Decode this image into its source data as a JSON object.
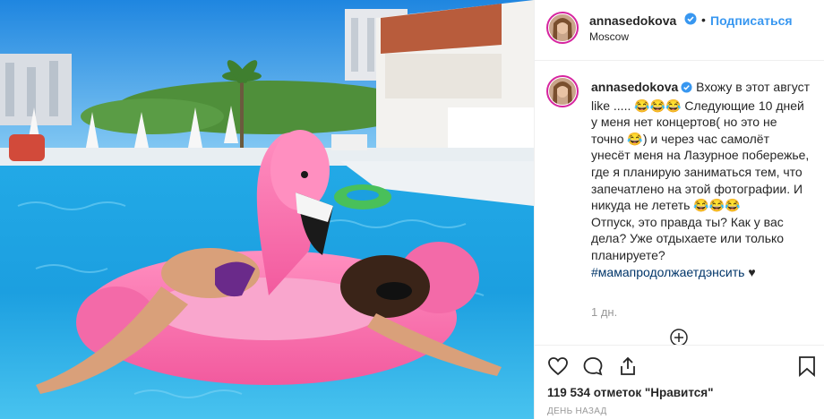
{
  "post": {
    "photo_alt": "photo",
    "author": {
      "username": "annasedokova",
      "verified": true,
      "follow_label": "Подписаться",
      "location": "Moscow"
    },
    "caption": {
      "username": "annasedokova",
      "text": "Вхожу в этот август like ..... 😂😂😂 Следующие 10 дней у меня нет концертов( но это не точно 😂) и через час самолёт унесёт меня на Лазурное побережье, где я планирую заниматься тем, что запечатлено на этой фотографии. И никуда не лететь 😂😂😂",
      "question": "Отпуск, это правда ты? Как у вас дела? Уже отдыхаете или только планируете?",
      "hashtag": "#мамапродолжаетдэнсить",
      "heart": "♥"
    },
    "time_ago": "1 дн.",
    "likes_text": "119 534 отметок \"Нравится\"",
    "date_text": "день назад",
    "icons": {
      "like": "heart-outline-icon",
      "comment": "comment-bubble-icon",
      "share": "share-icon",
      "save": "bookmark-icon",
      "load_more": "plus-circle-icon",
      "verified": "verified-badge-icon"
    },
    "colors": {
      "link_blue": "#3897f0",
      "hashtag": "#003569",
      "muted": "#999999",
      "text": "#262626"
    }
  }
}
